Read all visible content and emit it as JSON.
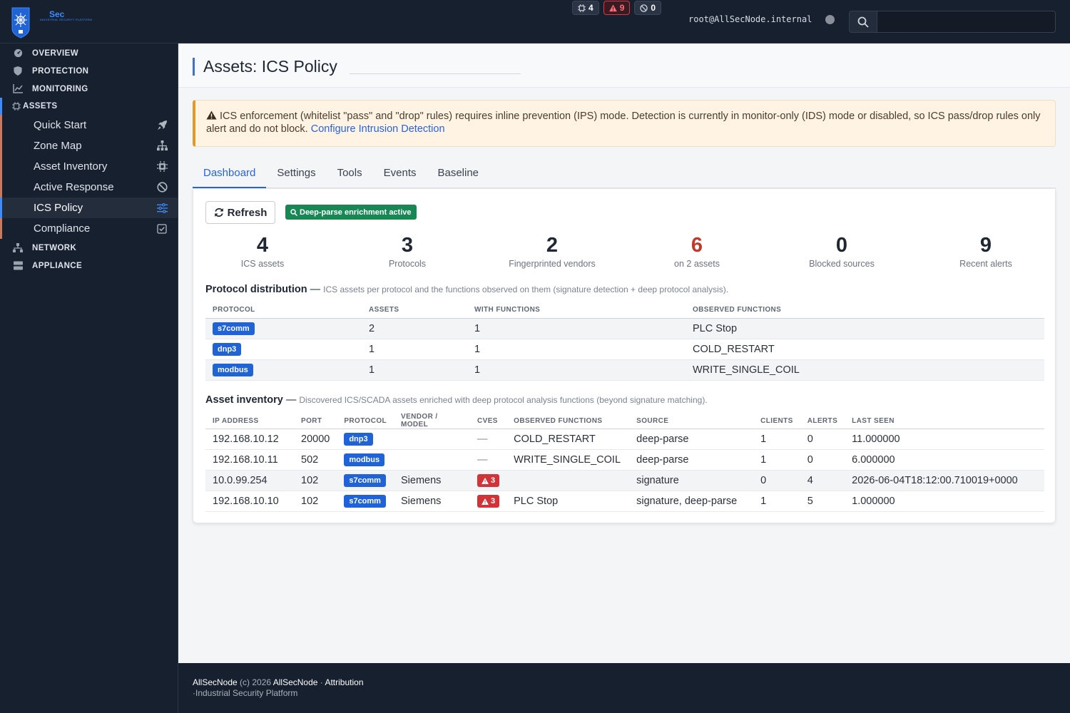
{
  "brand": {
    "name": "Sec",
    "subtitle": "INDUSTRIAL SECURITY PLATFORM"
  },
  "topbar": {
    "badges": [
      {
        "icon": "cpu-icon",
        "value": "4"
      },
      {
        "icon": "warning-icon",
        "value": "9"
      },
      {
        "icon": "ban-icon",
        "value": "0"
      }
    ],
    "user": "root@AllSecNode.internal",
    "search": {
      "placeholder": ""
    }
  },
  "sidebar": {
    "sections": [
      {
        "label": "OVERVIEW",
        "icon": "dashboard-icon"
      },
      {
        "label": "PROTECTION",
        "icon": "shield-icon"
      },
      {
        "label": "MONITORING",
        "icon": "chart-line-icon"
      },
      {
        "label": "ASSETS",
        "icon": "cpu-icon"
      },
      {
        "label": "NETWORK",
        "icon": "network-icon"
      },
      {
        "label": "APPLIANCE",
        "icon": "server-icon"
      }
    ],
    "assets_items": [
      {
        "label": "Quick Start",
        "icon": "rocket-icon"
      },
      {
        "label": "Zone Map",
        "icon": "sitemap-icon"
      },
      {
        "label": "Asset Inventory",
        "icon": "cpu-icon"
      },
      {
        "label": "Active Response",
        "icon": "ban-icon"
      },
      {
        "label": "ICS Policy",
        "icon": "sliders-icon"
      },
      {
        "label": "Compliance",
        "icon": "check-square-icon"
      }
    ]
  },
  "page": {
    "title": "Assets: ICS Policy"
  },
  "alert": {
    "text": "ICS enforcement (whitelist \"pass\" and \"drop\" rules) requires inline prevention (IPS) mode. Detection is currently in monitor-only (IDS) mode or disabled, so ICS pass/drop rules only alert and do not block.",
    "link": "Configure Intrusion Detection"
  },
  "tabs": [
    "Dashboard",
    "Settings",
    "Tools",
    "Events",
    "Baseline"
  ],
  "toolbar": {
    "refresh_label": "Refresh",
    "deep_parse_label": "Deep-parse enrichment active"
  },
  "stats": [
    {
      "value": "4",
      "label": "ICS assets"
    },
    {
      "value": "3",
      "label": "Protocols"
    },
    {
      "value": "2",
      "label": "Fingerprinted vendors"
    },
    {
      "value": "6",
      "label": "on 2 assets",
      "color": "#c0392b"
    },
    {
      "value": "0",
      "label": "Blocked sources"
    },
    {
      "value": "9",
      "label": "Recent alerts"
    }
  ],
  "protocol_dist": {
    "title": "Protocol distribution",
    "desc": "ICS assets per protocol and the functions observed on them (signature detection + deep protocol analysis).",
    "headers": [
      "PROTOCOL",
      "ASSETS",
      "WITH FUNCTIONS",
      "OBSERVED FUNCTIONS"
    ],
    "rows": [
      [
        "s7comm",
        "2",
        "1",
        "PLC Stop"
      ],
      [
        "dnp3",
        "1",
        "1",
        "COLD_RESTART"
      ],
      [
        "modbus",
        "1",
        "1",
        "WRITE_SINGLE_COIL"
      ]
    ]
  },
  "inventory": {
    "title": "Asset inventory",
    "desc": "Discovered ICS/SCADA assets enriched with deep protocol analysis functions (beyond signature matching).",
    "headers": [
      "IP ADDRESS",
      "PORT",
      "PROTOCOL",
      "VENDOR / MODEL",
      "CVES",
      "OBSERVED FUNCTIONS",
      "SOURCE",
      "CLIENTS",
      "ALERTS",
      "LAST SEEN"
    ],
    "rows": [
      [
        "192.168.10.12",
        "20000",
        "dnp3",
        "",
        "—",
        "COLD_RESTART",
        "deep-parse",
        "1",
        "0",
        "11.000000"
      ],
      [
        "192.168.10.11",
        "502",
        "modbus",
        "",
        "—",
        "WRITE_SINGLE_COIL",
        "deep-parse",
        "1",
        "0",
        "6.000000"
      ],
      [
        "10.0.99.254",
        "102",
        "s7comm",
        "Siemens",
        "3",
        "",
        "signature",
        "0",
        "4",
        "2026-06-04T18:12:00.710019+0000"
      ],
      [
        "192.168.10.10",
        "102",
        "s7comm",
        "Siemens",
        "3",
        "PLC Stop",
        "signature, deep-parse",
        "1",
        "5",
        "1.000000"
      ]
    ]
  },
  "footer": {
    "brand": "AllSecNode",
    "copyright": "(c) 2026",
    "owner": "AllSecNode",
    "sep": "·",
    "attribution": "Attribution",
    "tagline": "·Industrial Security Platform"
  }
}
